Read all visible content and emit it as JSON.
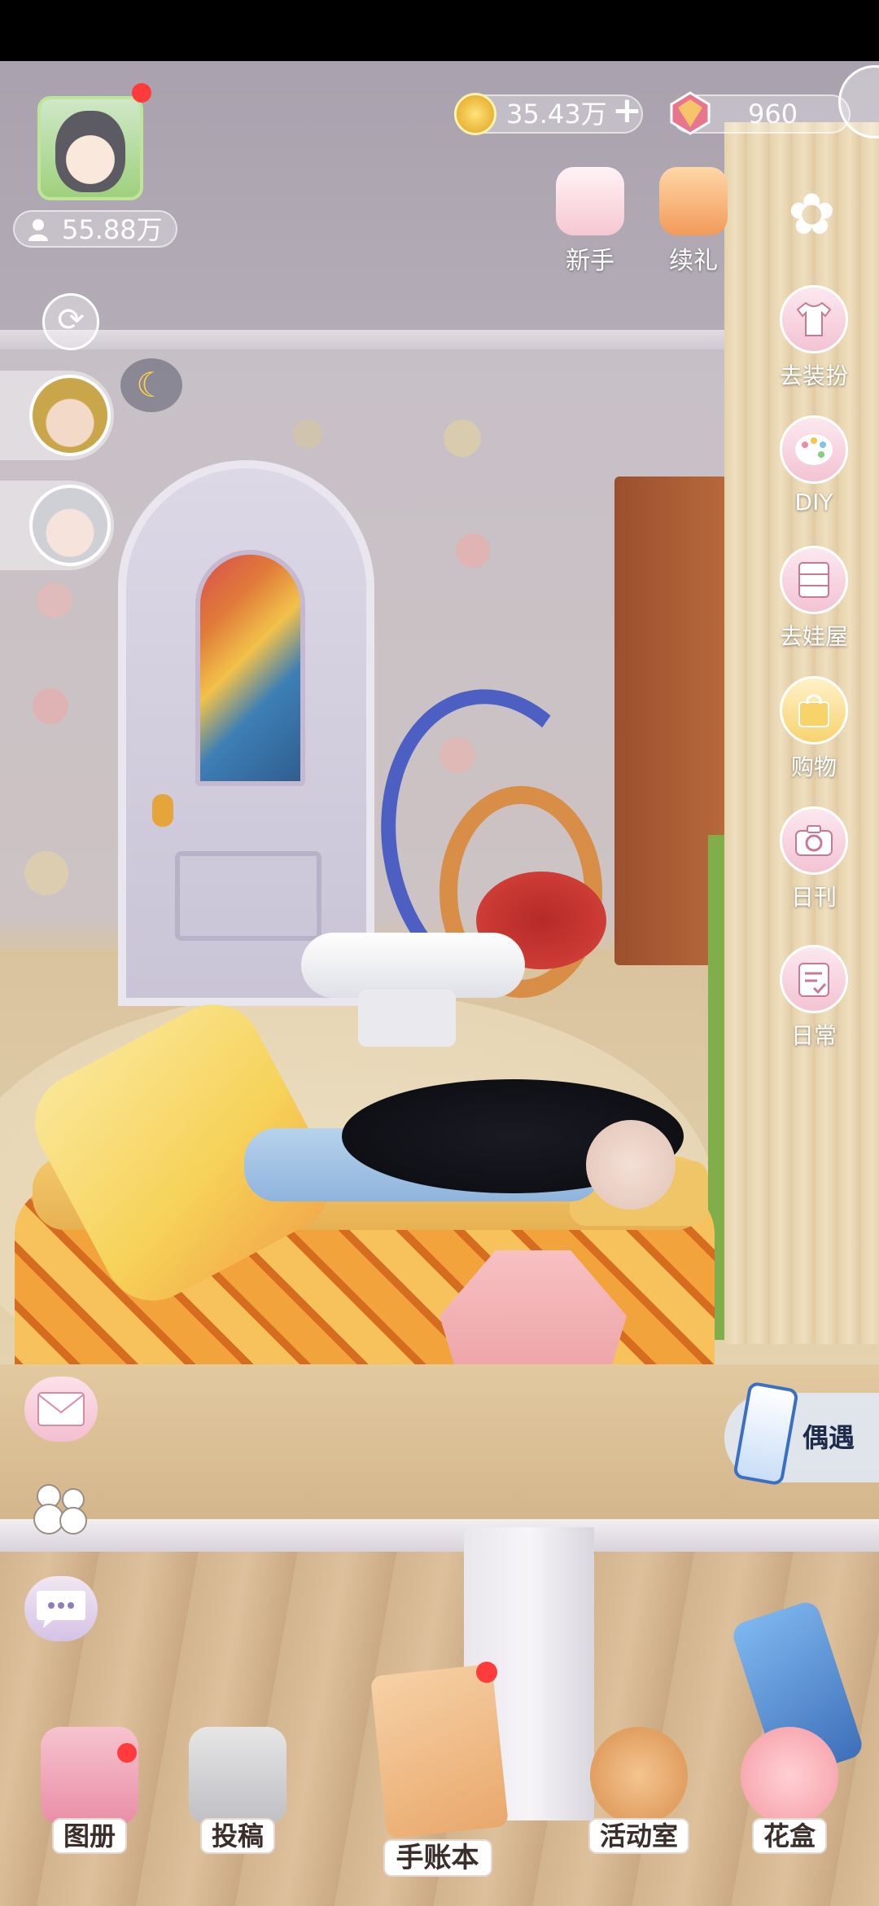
{
  "hud": {
    "fans_count": "55.88万",
    "coins": "35.43万",
    "coin_add": "+",
    "gems": "960"
  },
  "top_actions": {
    "newbie": "新手",
    "gift": "续礼"
  },
  "side_menu": [
    {
      "label": "去装扮",
      "icon": "shirt-icon"
    },
    {
      "label": "DIY",
      "icon": "palette-icon"
    },
    {
      "label": "去娃屋",
      "icon": "cabinet-icon"
    },
    {
      "label": "购物",
      "icon": "shopping-bag-icon"
    },
    {
      "label": "日刊",
      "icon": "camera-icon"
    },
    {
      "label": "日常",
      "icon": "checklist-icon"
    }
  ],
  "encounter": {
    "label": "偶遇"
  },
  "bottom_nav": [
    {
      "label": "图册",
      "icon": "album-icon",
      "badge": true
    },
    {
      "label": "投稿",
      "icon": "clapperboard-icon",
      "badge": false
    },
    {
      "label": "手账本",
      "icon": "journal-icon",
      "badge": true
    },
    {
      "label": "活动室",
      "icon": "teddy-bear-icon",
      "badge": false
    },
    {
      "label": "花盒",
      "icon": "flower-box-icon",
      "badge": false
    }
  ],
  "colors": {
    "badge_red": "#ff3b3b",
    "hud_text": "#ffffff",
    "side_button_bg": "#f3c3d3"
  }
}
